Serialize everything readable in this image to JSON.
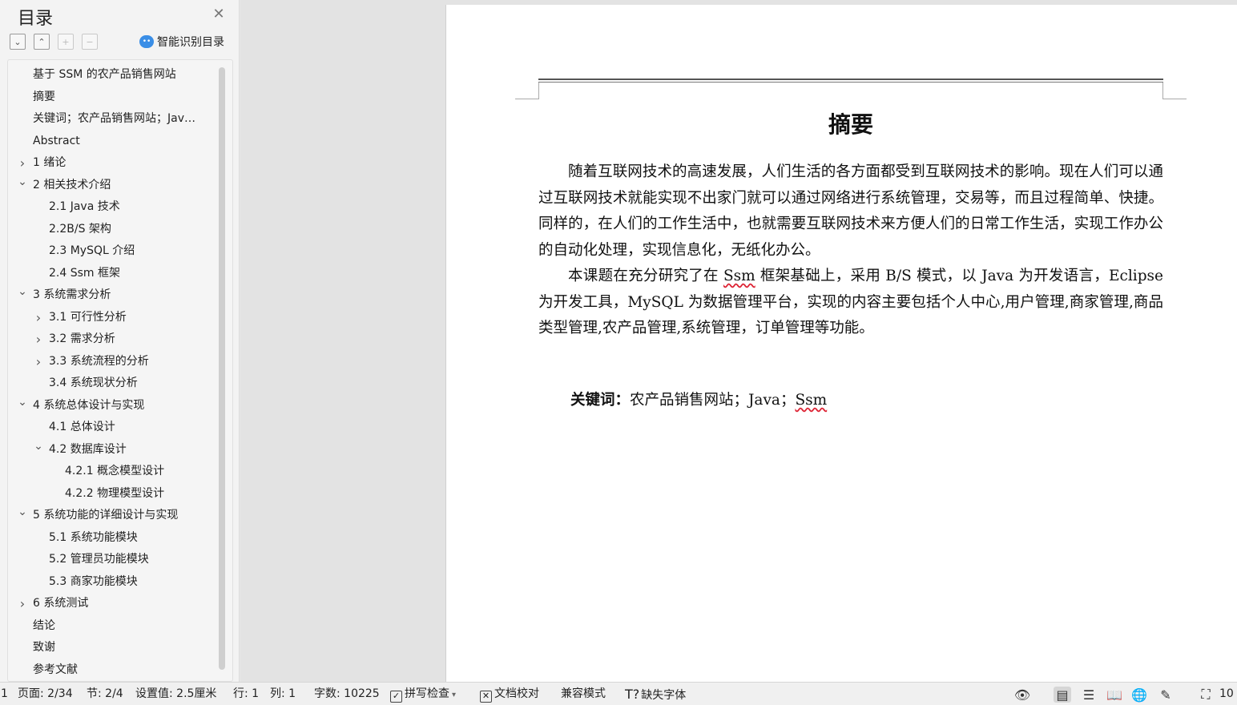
{
  "sidebar": {
    "title": "目录",
    "smart_toc_label": "智能识别目录",
    "toc": [
      {
        "text": "基于 SSM 的农产品销售网站",
        "level": 0,
        "arrow": ""
      },
      {
        "text": "摘要",
        "level": 0,
        "arrow": ""
      },
      {
        "text": "关键词；农产品销售网站；Jav…",
        "level": 0,
        "arrow": ""
      },
      {
        "text": "Abstract",
        "level": 0,
        "arrow": ""
      },
      {
        "text": "1  绪论",
        "level": 0,
        "arrow": "right"
      },
      {
        "text": "2 相关技术介绍",
        "level": 0,
        "arrow": "down"
      },
      {
        "text": "2.1 Java 技术",
        "level": 1,
        "arrow": ""
      },
      {
        "text": "2.2B/S 架构",
        "level": 1,
        "arrow": ""
      },
      {
        "text": "2.3 MySQL 介绍",
        "level": 1,
        "arrow": ""
      },
      {
        "text": "2.4 Ssm 框架",
        "level": 1,
        "arrow": ""
      },
      {
        "text": "3 系统需求分析",
        "level": 0,
        "arrow": "down"
      },
      {
        "text": "3.1  可行性分析",
        "level": 1,
        "arrow": "right"
      },
      {
        "text": "3.2  需求分析",
        "level": 1,
        "arrow": "right"
      },
      {
        "text": "3.3 系统流程的分析",
        "level": 1,
        "arrow": "right"
      },
      {
        "text": "3.4  系统现状分析",
        "level": 1,
        "arrow": ""
      },
      {
        "text": "4 系统总体设计与实现",
        "level": 0,
        "arrow": "down"
      },
      {
        "text": "4.1  总体设计",
        "level": 1,
        "arrow": ""
      },
      {
        "text": "4.2  数据库设计",
        "level": 1,
        "arrow": "down"
      },
      {
        "text": "4.2.1 概念模型设计",
        "level": 2,
        "arrow": ""
      },
      {
        "text": "4.2.2 物理模型设计",
        "level": 2,
        "arrow": ""
      },
      {
        "text": "5  系统功能的详细设计与实现",
        "level": 0,
        "arrow": "down"
      },
      {
        "text": "5.1 系统功能模块",
        "level": 1,
        "arrow": ""
      },
      {
        "text": "5.2 管理员功能模块",
        "level": 1,
        "arrow": ""
      },
      {
        "text": "5.3  商家功能模块",
        "level": 1,
        "arrow": ""
      },
      {
        "text": "6  系统测试",
        "level": 0,
        "arrow": "right"
      },
      {
        "text": "结论",
        "level": 0,
        "arrow": ""
      },
      {
        "text": "致谢",
        "level": 0,
        "arrow": ""
      },
      {
        "text": "参考文献",
        "level": 0,
        "arrow": ""
      }
    ]
  },
  "document": {
    "heading": "摘要",
    "para1": "随着互联网技术的高速发展，人们生活的各方面都受到互联网技术的影响。现在人们可以通过互联网技术就能实现不出家门就可以通过网络进行系统管理，交易等，而且过程简单、快捷。同样的，在人们的工作生活中，也就需要互联网技术来方便人们的日常工作生活，实现工作办公的自动化处理，实现信息化，无纸化办公。",
    "para2_a": "本课题在充分研究了在 ",
    "para2_ssm": "Ssm",
    "para2_b": " 框架基础上，采用 B/S 模式，以 Java 为开发语言，Eclipse 为开发工具，MySQL 为数据管理平台，实现的内容主要包括个人中心,用户管理,商家管理,商品类型管理,农产品管理,系统管理，订单管理等功能。",
    "keywords_label": "关键词：",
    "keywords_text": "农产品销售网站；Java；",
    "keywords_ssm": "Ssm"
  },
  "statusbar": {
    "left_edge": "1",
    "page": "页面: 2/34",
    "section": "节: 2/4",
    "setting": "设置值: 2.5厘米",
    "row": "行: 1",
    "col": "列: 1",
    "wordcount": "字数: 10225",
    "spellcheck": "拼写检查",
    "proofread": "文档校对",
    "compat": "兼容模式",
    "missing_font": "缺失字体",
    "zoom_partial": "10"
  }
}
